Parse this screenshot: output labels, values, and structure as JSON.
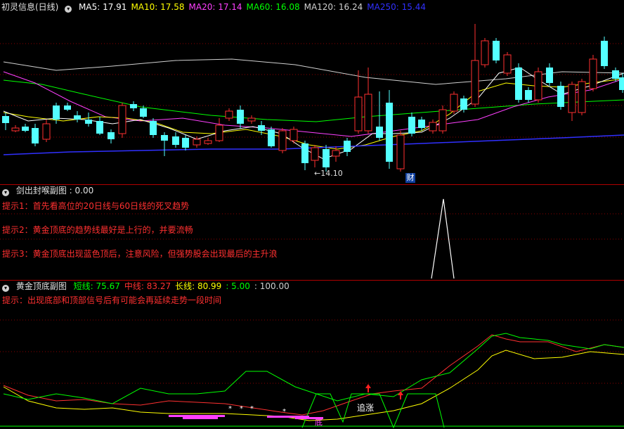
{
  "main_panel": {
    "title": "初灵信息(日线)",
    "ma": [
      {
        "label": "MA5: 17.91",
        "color": "#ffffff"
      },
      {
        "label": "MA10: 17.58",
        "color": "#ffff00"
      },
      {
        "label": "MA20: 17.14",
        "color": "#ff40ff"
      },
      {
        "label": "MA60: 16.08",
        "color": "#00ff00"
      },
      {
        "label": "MA120: 16.24",
        "color": "#d0d0d0"
      },
      {
        "label": "MA250: 15.44",
        "color": "#3030ff"
      }
    ],
    "low_marker": "←14.10",
    "cai_badge": "财"
  },
  "sub_panel_1": {
    "title": "剑出封喉副图 : 0.00",
    "hints": [
      "提示1：首先看高位的20日线与60日线的死叉趋势",
      "提示2：黄金顶底的趋势线最好是上行的，并要流畅",
      "提示3：黄金顶底出现蓝色顶后，注意风险，但强势股会出现最后的主升浪"
    ]
  },
  "sub_panel_2": {
    "title": "黄金顶底副图",
    "values": [
      {
        "label": "短线: 75.67",
        "color": "#00ff00"
      },
      {
        "label": "中线: 83.27",
        "color": "#ff3030"
      },
      {
        "label": "长线: 80.99",
        "color": "#ffff00"
      },
      {
        "label": ": 5.00",
        "color": "#00ff00"
      },
      {
        "label": ": 100.00",
        "color": "#d0d0d0"
      }
    ],
    "hint": "提示：出现底部和顶部信号后有可能会再延续走势一段时间",
    "zhuizhang": "追涨",
    "di": "底",
    "stars": [
      "*",
      "*",
      "*",
      "*"
    ]
  },
  "colors": {
    "up": "#ff3030",
    "down": "#54ffff",
    "separator": "#b00000",
    "grid": "#8b0000"
  }
}
